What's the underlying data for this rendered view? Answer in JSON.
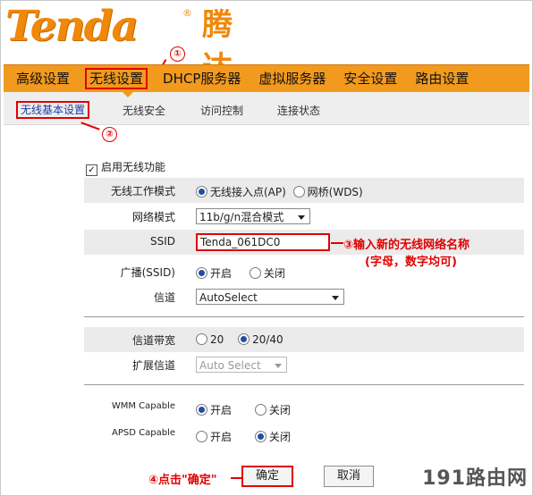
{
  "logo": {
    "brand_en": "Tenda",
    "reg_mark": "®",
    "brand_cn": "腾达"
  },
  "nav": {
    "items": [
      "高级设置",
      "无线设置",
      "DHCP服务器",
      "虚拟服务器",
      "安全设置",
      "路由设置"
    ],
    "active_index": 1
  },
  "subnav": {
    "items": [
      "无线基本设置",
      "无线安全",
      "访问控制",
      "连接状态"
    ],
    "active_index": 0
  },
  "form": {
    "enable_wireless": {
      "label": "启用无线功能",
      "checked": true
    },
    "work_mode": {
      "label": "无线工作模式",
      "options": [
        "无线接入点(AP)",
        "网桥(WDS)"
      ],
      "selected": 0
    },
    "network_mode": {
      "label": "网络模式",
      "value": "11b/g/n混合模式"
    },
    "ssid": {
      "label": "SSID",
      "value": "Tenda_061DC0"
    },
    "broadcast": {
      "label": "广播(SSID)",
      "options": [
        "开启",
        "关闭"
      ],
      "selected": 0
    },
    "channel": {
      "label": "信道",
      "value": "AutoSelect"
    },
    "bandwidth": {
      "label": "信道带宽",
      "options": [
        "20",
        "20/40"
      ],
      "selected": 1
    },
    "ext_channel": {
      "label": "扩展信道",
      "value": "Auto Select"
    },
    "wmm": {
      "label": "WMM Capable",
      "options": [
        "开启",
        "关闭"
      ],
      "selected": 0
    },
    "apsd": {
      "label": "APSD Capable",
      "options": [
        "开启",
        "关闭"
      ],
      "selected": 1
    }
  },
  "buttons": {
    "confirm": "确定",
    "cancel": "取消"
  },
  "annotations": {
    "step1": "①",
    "step2": "②",
    "step3": "③输入新的无线网络名称",
    "step3_sub": "(字母，数字均可)",
    "step4": "④点击\"确定\""
  },
  "watermark": "191路由网",
  "colors": {
    "accent": "#f29a1e",
    "highlight": "#e00000",
    "logo": "#f0880a"
  }
}
